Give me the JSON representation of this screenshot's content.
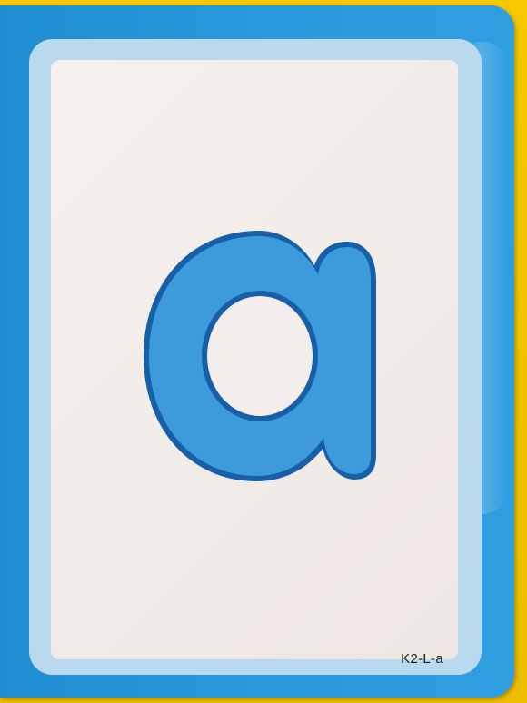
{
  "card": {
    "letter": "a",
    "code": "K2-L-a"
  },
  "colors": {
    "background": "#f2c200",
    "card_blue": "#2a9ade",
    "frame_light_blue": "#b9d9ee",
    "panel": "#f3eeeb",
    "letter_fill": "#3d9bdc",
    "letter_outline": "#1760a8"
  }
}
